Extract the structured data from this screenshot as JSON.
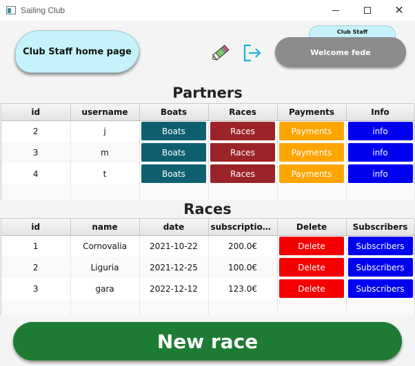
{
  "window": {
    "title": "Sailing Club"
  },
  "header": {
    "home_label": "Club Staff home page",
    "staff_badge": "Club Staff",
    "welcome": "Welcome fede"
  },
  "partners": {
    "title": "Partners",
    "columns": [
      "id",
      "username",
      "Boats",
      "Races",
      "Payments",
      "Info"
    ],
    "rows": [
      {
        "id": "2",
        "username": "j",
        "boats": "Boats",
        "races": "Races",
        "payments": "Payments",
        "info": "info"
      },
      {
        "id": "3",
        "username": "m",
        "boats": "Boats",
        "races": "Races",
        "payments": "Payments",
        "info": "info"
      },
      {
        "id": "4",
        "username": "t",
        "boats": "Boats",
        "races": "Races",
        "payments": "Payments",
        "info": "info"
      }
    ]
  },
  "races": {
    "title": "Races",
    "columns": [
      "id",
      "name",
      "date",
      "subscription p...",
      "Delete",
      "Subscribers"
    ],
    "rows": [
      {
        "id": "1",
        "name": "Cornovalia",
        "date": "2021-10-22",
        "price": "200.0€",
        "delete": "Delete",
        "subscribers": "Subscribers"
      },
      {
        "id": "2",
        "name": "Liguria",
        "date": "2021-12-25",
        "price": "100.0€",
        "delete": "Delete",
        "subscribers": "Subscribers"
      },
      {
        "id": "3",
        "name": "gara",
        "date": "2022-12-12",
        "price": "123.0€",
        "delete": "Delete",
        "subscribers": "Subscribers"
      }
    ]
  },
  "actions": {
    "new_race": "New race"
  },
  "colors": {
    "boats": "#0e6070",
    "races": "#9b2428",
    "payments": "#ffa500",
    "info": "#0000f0",
    "delete": "#f50000",
    "subscribers": "#0000f0",
    "new_race": "#1e7b34",
    "home_pill": "#c6f3fb"
  }
}
